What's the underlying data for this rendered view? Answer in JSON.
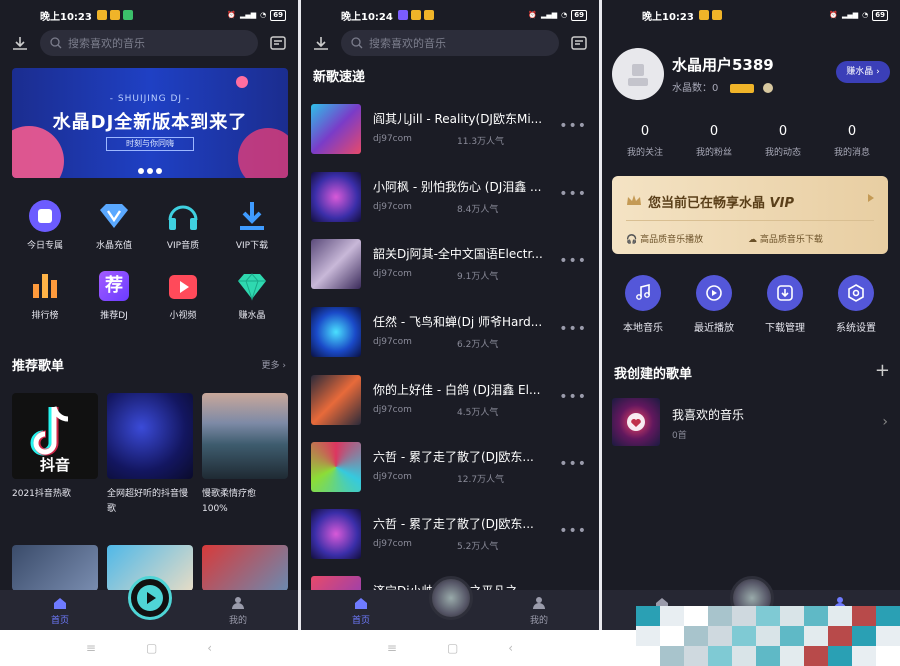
{
  "screen1": {
    "status": {
      "time": "晚上10:23",
      "battery": "69"
    },
    "search_placeholder": "搜索喜欢的音乐",
    "banner": {
      "subtitle": "- SHUIJING DJ -",
      "title": "水晶DJ全新版本到来了",
      "tagline": "时刻与你同嗨"
    },
    "features": [
      {
        "label": "今日专属",
        "icon": "square-icon",
        "color": "#6c5cff"
      },
      {
        "label": "水晶充值",
        "icon": "diamond-v-icon",
        "color": "#5aa8ff"
      },
      {
        "label": "VIP音质",
        "icon": "headphones-icon",
        "color": "#3fd0e0"
      },
      {
        "label": "VIP下载",
        "icon": "download-icon",
        "color": "#3f9bff"
      },
      {
        "label": "排行榜",
        "icon": "bars-icon",
        "color": "#ff9a3c"
      },
      {
        "label": "推荐DJ",
        "icon": "recommend-icon",
        "color": "#8a4dff",
        "glyph": "荐"
      },
      {
        "label": "小视频",
        "icon": "video-icon",
        "color": "#ff4a5a"
      },
      {
        "label": "赚水晶",
        "icon": "gem-icon",
        "color": "#2fd8b0"
      }
    ],
    "section_title": "推荐歌单",
    "more_label": "更多",
    "playlists": [
      {
        "caption": "2021抖音热歌",
        "tile_text": "抖音"
      },
      {
        "caption": "全网超好听的抖音慢歌",
        "tile_text": ""
      },
      {
        "caption": "慢歌柔情疗愈100%",
        "tile_text": ""
      }
    ],
    "nav": {
      "home": "首页",
      "mine": "我的"
    }
  },
  "screen2": {
    "status": {
      "time": "晚上10:24",
      "battery": "69"
    },
    "search_placeholder": "搜索喜欢的音乐",
    "title": "新歌速递",
    "songs": [
      {
        "name": "阎其儿Jill - Reality(DJ欧东Mi...",
        "source": "dj97com",
        "plays": "11.3万人气"
      },
      {
        "name": "小阿枫 - 别怕我伤心 (DJ泪鑫 ...",
        "source": "dj97com",
        "plays": "8.4万人气"
      },
      {
        "name": "韶关Dj阿其-全中文国语Electr...",
        "source": "dj97com",
        "plays": "9.1万人气"
      },
      {
        "name": "任然 - 飞鸟和蝉(Dj 师爷Hard...",
        "source": "dj97com",
        "plays": "6.2万人气"
      },
      {
        "name": "你的上好佳 - 白鸽 (DJ泪鑫 El...",
        "source": "dj97com",
        "plays": "4.5万人气"
      },
      {
        "name": "六哲 - 累了走了散了(DJ欧东...",
        "source": "dj97com",
        "plays": "12.7万人气"
      },
      {
        "name": "六哲 - 累了走了散了(DJ欧东...",
        "source": "dj97com",
        "plays": "5.2万人气"
      },
      {
        "name": "济宁Dj小帅 - 战鼓之平凡之...",
        "source": "",
        "plays": ""
      }
    ],
    "nav": {
      "home": "首页",
      "mine": "我的"
    }
  },
  "screen3": {
    "status": {
      "time": "晚上10:23",
      "battery": "69"
    },
    "username": "水晶用户5389",
    "crystal_label": "水晶数：0",
    "earn_button": "赚水晶",
    "stats": [
      {
        "value": "0",
        "label": "我的关注"
      },
      {
        "value": "0",
        "label": "我的粉丝"
      },
      {
        "value": "0",
        "label": "我的动态"
      },
      {
        "value": "0",
        "label": "我的消息"
      }
    ],
    "vip": {
      "title_prefix": "您当前已在畅享水晶",
      "title_vip": "VIP",
      "feature1": "高品质音乐播放",
      "feature2": "高品质音乐下载"
    },
    "tools": [
      {
        "label": "本地音乐",
        "icon": "music-note-icon"
      },
      {
        "label": "最近播放",
        "icon": "recent-play-icon"
      },
      {
        "label": "下载管理",
        "icon": "download-manage-icon"
      },
      {
        "label": "系统设置",
        "icon": "settings-icon"
      }
    ],
    "created_title": "我创建的歌单",
    "playlist": {
      "name": "我喜欢的音乐",
      "count": "0首"
    }
  }
}
